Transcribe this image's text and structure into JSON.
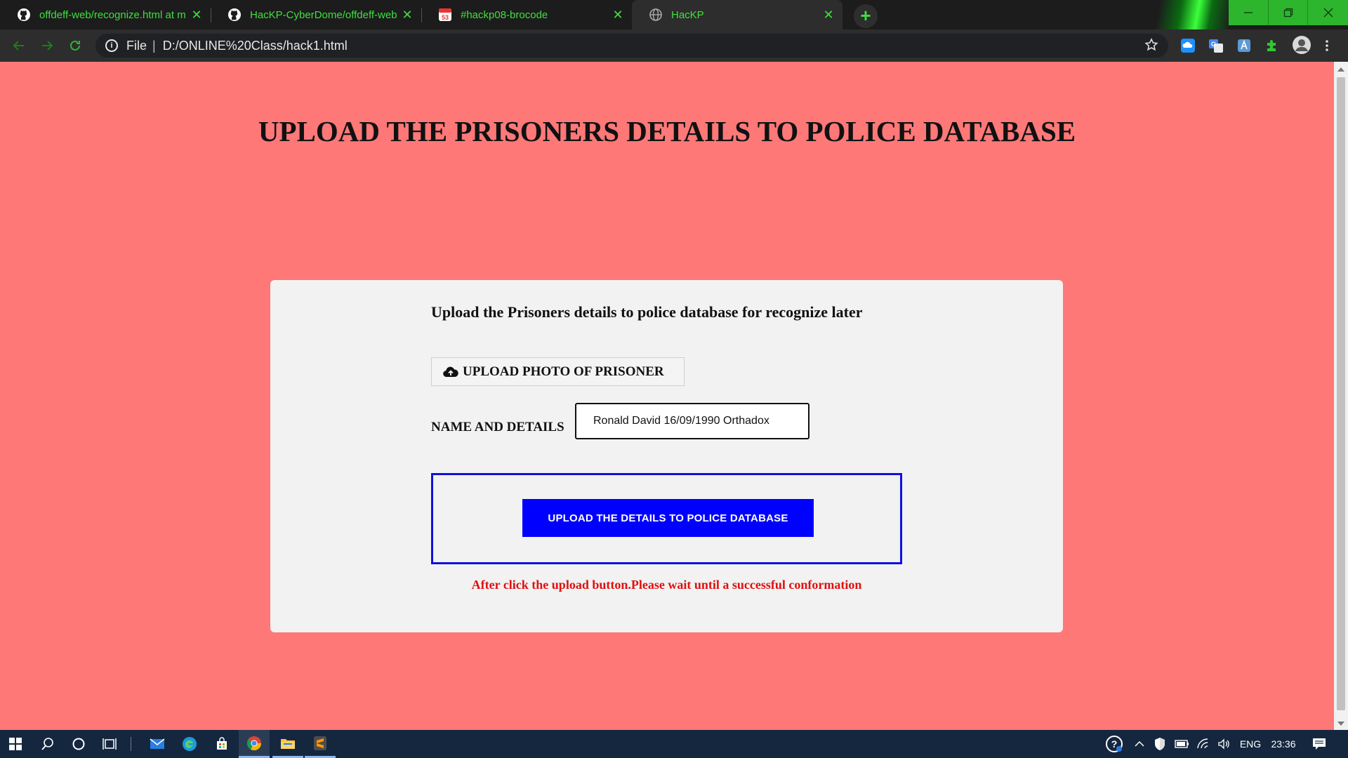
{
  "browser": {
    "tabs": [
      {
        "label": "offdeff-web/recognize.html at m",
        "icon": "github-icon"
      },
      {
        "label": "HacKP-CyberDome/offdeff-web",
        "icon": "github-icon"
      },
      {
        "label": "#hackp08-brocode",
        "icon": "calendar-app-icon",
        "badge": "53"
      },
      {
        "label": "HacKP",
        "icon": "globe-icon"
      }
    ],
    "active_tab_index": 3,
    "close_glyph": "✕",
    "new_tab_glyph": "+",
    "address": {
      "scheme": "File",
      "separator": "|",
      "url": "D:/ONLINE%20Class/hack1.html"
    }
  },
  "page": {
    "title": "UPLOAD THE PRISONERS DETAILS TO POLICE DATABASE",
    "card": {
      "heading": "Upload the Prisoners details to police database for recognize later",
      "photo_button_label": "UPLOAD PHOTO OF PRISONER",
      "name_label": "NAME AND DETAILS",
      "name_value": "Ronald David 16/09/1990 Orthadox",
      "submit_label": "UPLOAD THE DETAILS TO POLICE DATABASE",
      "notice": "After click the upload button.Please wait until a successful conformation"
    }
  },
  "taskbar": {
    "language": "ENG",
    "time": "23:36"
  },
  "colors": {
    "page_background": "#ff7878",
    "card_background": "#f2f2f2",
    "submit_button": "#0000ff",
    "notice_text": "#e01010",
    "tab_text": "#3ee03e"
  }
}
